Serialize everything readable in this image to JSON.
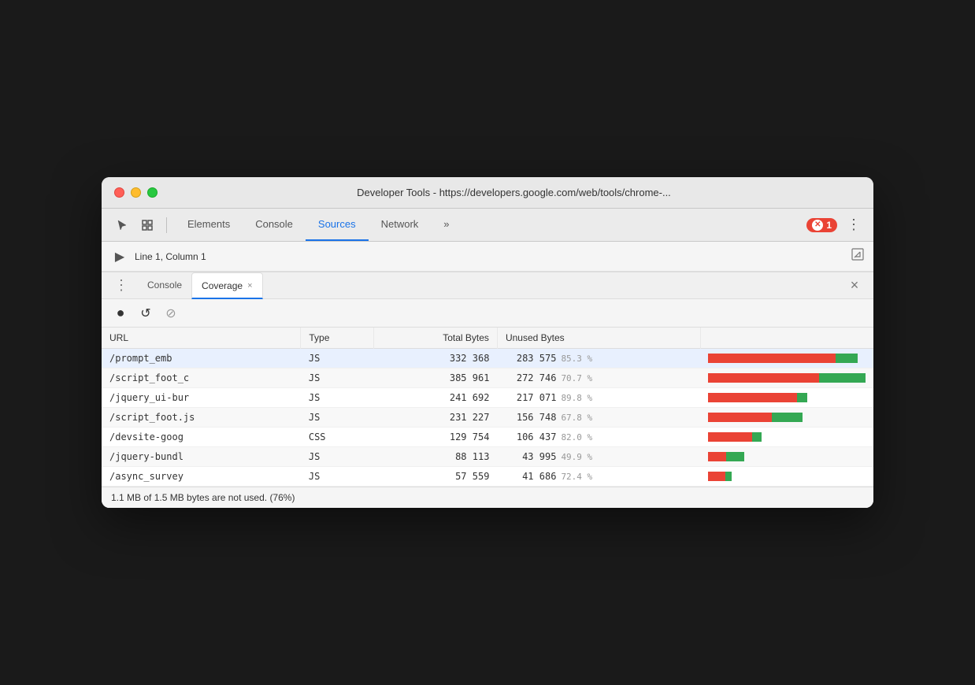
{
  "window": {
    "title": "Developer Tools - https://developers.google.com/web/tools/chrome-..."
  },
  "toolbar": {
    "cursor_icon": "cursor",
    "inspect_icon": "inspect",
    "tabs": [
      {
        "label": "Elements",
        "active": false
      },
      {
        "label": "Console",
        "active": false
      },
      {
        "label": "Sources",
        "active": true
      },
      {
        "label": "Network",
        "active": false
      },
      {
        "label": "»",
        "active": false
      }
    ],
    "error_count": "1",
    "more_label": "⋮"
  },
  "secondary_bar": {
    "play_icon": "▶",
    "position": "Line 1, Column 1"
  },
  "panel": {
    "more_label": "⋮",
    "tabs": [
      {
        "label": "Console",
        "active": false,
        "closeable": false
      },
      {
        "label": "Coverage",
        "active": true,
        "closeable": true
      }
    ],
    "close_label": "×"
  },
  "coverage_toolbar": {
    "record_label": "●",
    "reload_label": "↺",
    "clear_label": "⊘"
  },
  "table": {
    "columns": [
      "URL",
      "Type",
      "Total Bytes",
      "Unused Bytes",
      ""
    ],
    "rows": [
      {
        "url": "/prompt_emb",
        "type": "JS",
        "total_bytes": "332 368",
        "unused_bytes": "283 575",
        "unused_pct": "85.3 %",
        "used_ratio": 0.147,
        "bar_width_ratio": 0.95
      },
      {
        "url": "/script_foot_c",
        "type": "JS",
        "total_bytes": "385 961",
        "unused_bytes": "272 746",
        "unused_pct": "70.7 %",
        "used_ratio": 0.293,
        "bar_width_ratio": 1.0
      },
      {
        "url": "/jquery_ui-bur",
        "type": "JS",
        "total_bytes": "241 692",
        "unused_bytes": "217 071",
        "unused_pct": "89.8 %",
        "used_ratio": 0.102,
        "bar_width_ratio": 0.63
      },
      {
        "url": "/script_foot.js",
        "type": "JS",
        "total_bytes": "231 227",
        "unused_bytes": "156 748",
        "unused_pct": "67.8 %",
        "used_ratio": 0.322,
        "bar_width_ratio": 0.6
      },
      {
        "url": "/devsite-goog",
        "type": "CSS",
        "total_bytes": "129 754",
        "unused_bytes": "106 437",
        "unused_pct": "82.0 %",
        "used_ratio": 0.18,
        "bar_width_ratio": 0.34
      },
      {
        "url": "/jquery-bundl",
        "type": "JS",
        "total_bytes": "88 113",
        "unused_bytes": "43 995",
        "unused_pct": "49.9 %",
        "used_ratio": 0.501,
        "bar_width_ratio": 0.23
      },
      {
        "url": "/async_survey",
        "type": "JS",
        "total_bytes": "57 559",
        "unused_bytes": "41 686",
        "unused_pct": "72.4 %",
        "used_ratio": 0.276,
        "bar_width_ratio": 0.15
      }
    ]
  },
  "footer": {
    "text": "1.1 MB of 1.5 MB bytes are not used. (76%)"
  }
}
